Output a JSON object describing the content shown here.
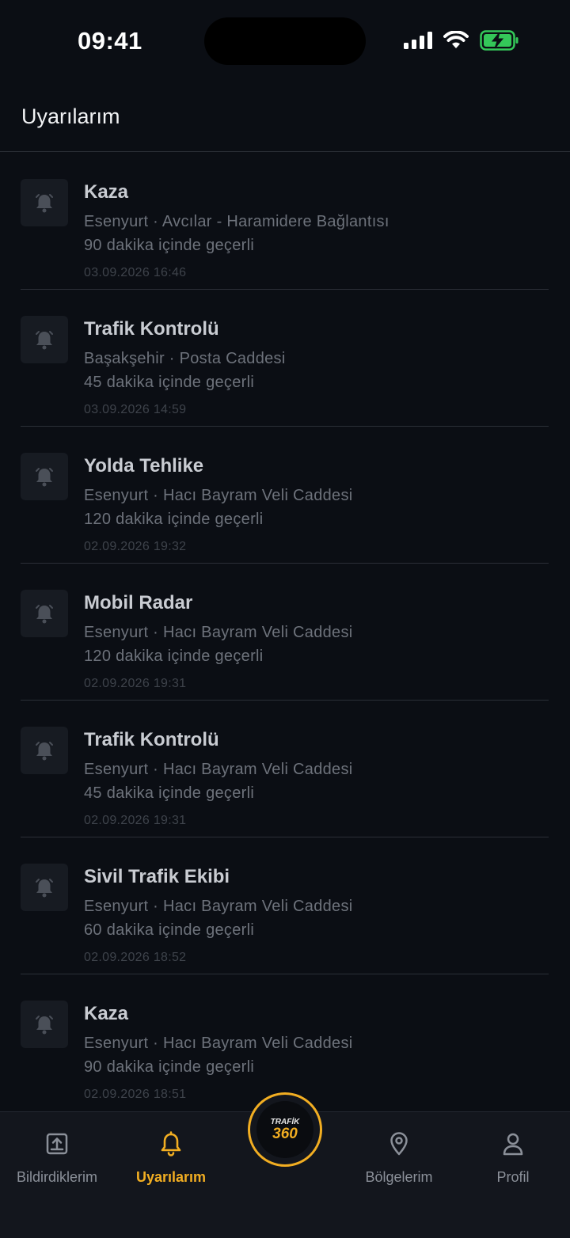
{
  "status_bar": {
    "time": "09:41"
  },
  "header": {
    "title": "Uyarılarım"
  },
  "alerts": [
    {
      "title": "Kaza",
      "location": "Esenyurt · Avcılar - Haramidere Bağlantısı",
      "validity": "90 dakika içinde geçerli",
      "timestamp": "03.09.2026  16:46"
    },
    {
      "title": "Trafik Kontrolü",
      "location": "Başakşehir · Posta Caddesi",
      "validity": "45 dakika içinde geçerli",
      "timestamp": "03.09.2026  14:59"
    },
    {
      "title": "Yolda Tehlike",
      "location": "Esenyurt · Hacı Bayram Veli Caddesi",
      "validity": "120 dakika içinde geçerli",
      "timestamp": "02.09.2026  19:32"
    },
    {
      "title": "Mobil Radar",
      "location": "Esenyurt · Hacı Bayram Veli Caddesi",
      "validity": "120 dakika içinde geçerli",
      "timestamp": "02.09.2026  19:31"
    },
    {
      "title": "Trafik Kontrolü",
      "location": "Esenyurt · Hacı Bayram Veli Caddesi",
      "validity": "45 dakika içinde geçerli",
      "timestamp": "02.09.2026  19:31"
    },
    {
      "title": "Sivil Trafik Ekibi",
      "location": "Esenyurt · Hacı Bayram Veli Caddesi",
      "validity": "60 dakika içinde geçerli",
      "timestamp": "02.09.2026  18:52"
    },
    {
      "title": "Kaza",
      "location": "Esenyurt · Hacı Bayram Veli Caddesi",
      "validity": "90 dakika içinde geçerli",
      "timestamp": "02.09.2026  18:51"
    }
  ],
  "nav": {
    "items": [
      {
        "label": "Bildirdiklerim",
        "icon": "upload-box-icon",
        "active": false
      },
      {
        "label": "Uyarılarım",
        "icon": "bell-icon",
        "active": true
      },
      {
        "label": "Bölgelerim",
        "icon": "location-pin-icon",
        "active": false
      },
      {
        "label": "Profil",
        "icon": "user-icon",
        "active": false
      }
    ],
    "center_logo": {
      "top_text": "TRAFİK",
      "bottom_text": "360"
    }
  },
  "colors": {
    "background": "#0b0e14",
    "accent": "#f2ae22",
    "battery": "#34c759"
  }
}
